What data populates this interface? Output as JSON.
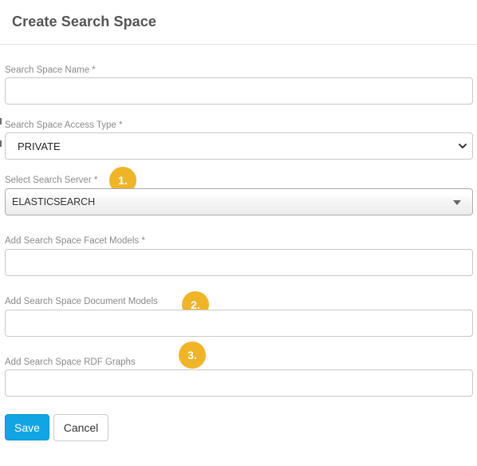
{
  "dialog": {
    "title": "Create Search Space"
  },
  "fields": {
    "name": {
      "label": "Search Space Name *",
      "value": ""
    },
    "access_type": {
      "label": "Search Space Access Type *",
      "selected": "PRIVATE"
    },
    "server": {
      "label": "Select Search Server *",
      "selected": "ELASTICSEARCH"
    },
    "facet_models": {
      "label": "Add Search Space Facet Models *",
      "value": ""
    },
    "document_models": {
      "label": "Add Search Space Document Models",
      "value": ""
    },
    "rdf_graphs": {
      "label": "Add Search Space RDF Graphs",
      "value": ""
    }
  },
  "annotations": {
    "badge1": "1.",
    "badge2": "2.",
    "badge3": "3.",
    "color": "#f0b429"
  },
  "actions": {
    "save_label": "Save",
    "cancel_label": "Cancel",
    "save_color": "#11a5e4"
  },
  "icons": {
    "access_type_dropdown": "chevron-down-icon",
    "server_dropdown": "caret-down-icon"
  }
}
